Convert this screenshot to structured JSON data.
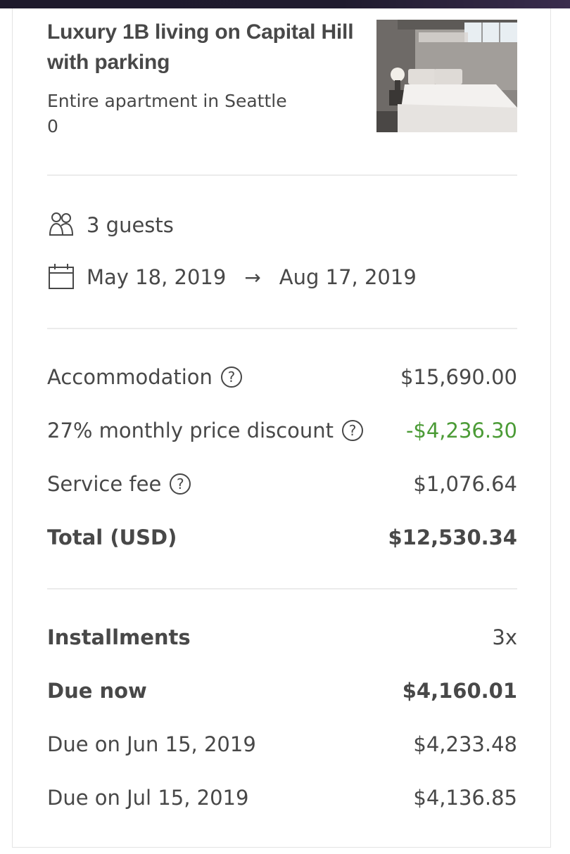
{
  "listing": {
    "title": "Luxury 1B living on Capital Hill with parking",
    "subtitle": "Entire apartment in Seattle",
    "count": "0"
  },
  "trip": {
    "guests": "3 guests",
    "check_in": "May 18, 2019",
    "arrow": "→",
    "check_out": "Aug 17, 2019"
  },
  "pricing": {
    "accommodation_label": "Accommodation",
    "accommodation_value": "$15,690.00",
    "discount_label": "27% monthly price discount",
    "discount_value": "-$4,236.30",
    "service_label": "Service fee",
    "service_value": "$1,076.64",
    "total_label": "Total (USD)",
    "total_value": "$12,530.34",
    "help_glyph": "?"
  },
  "installments": {
    "label": "Installments",
    "value": "3x",
    "due_now_label": "Due now",
    "due_now_value": "$4,160.01",
    "due_jun_label": "Due on Jun 15, 2019",
    "due_jun_value": "$4,233.48",
    "due_jul_label": "Due on Jul 15, 2019",
    "due_jul_value": "$4,136.85"
  },
  "colors": {
    "text": "#484848",
    "discount": "#4b9b36",
    "divider": "#ebebeb"
  },
  "icons": {
    "guests": "guests-icon",
    "calendar": "calendar-icon",
    "help": "help-icon",
    "listing_photo": "listing-photo"
  }
}
